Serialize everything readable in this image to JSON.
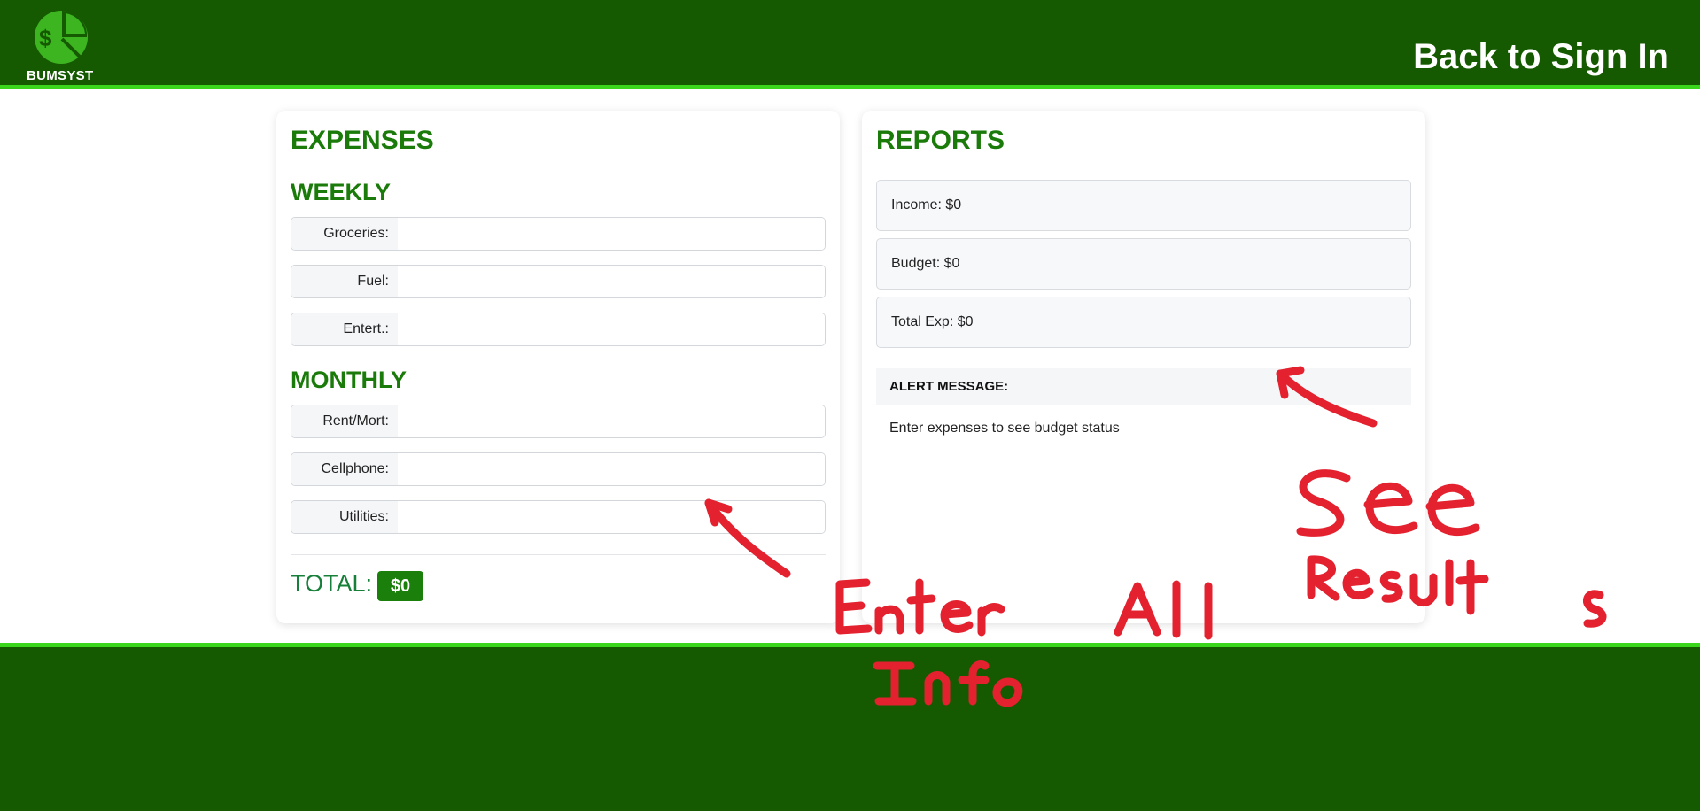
{
  "header": {
    "logo_text": "BUMSYST",
    "signin_link": "Back to Sign In"
  },
  "expenses": {
    "title": "EXPENSES",
    "weekly_title": "WEEKLY",
    "weekly": [
      {
        "label": "Groceries:",
        "value": ""
      },
      {
        "label": "Fuel:",
        "value": ""
      },
      {
        "label": "Entert.:",
        "value": ""
      }
    ],
    "monthly_title": "MONTHLY",
    "monthly": [
      {
        "label": "Rent/Mort:",
        "value": ""
      },
      {
        "label": "Cellphone:",
        "value": ""
      },
      {
        "label": "Utilities:",
        "value": ""
      }
    ],
    "total_label": "TOTAL:",
    "total_value": "$0"
  },
  "reports": {
    "title": "REPORTS",
    "items": [
      "Income: $0",
      "Budget: $0",
      "Total Exp: $0"
    ],
    "alert_title": "ALERT MESSAGE:",
    "alert_text": "Enter expenses to see budget status"
  },
  "annotations": {
    "enter_all_info": "Enter All Info",
    "see_results": "See Results"
  },
  "colors": {
    "header_bg": "#155a00",
    "accent_line": "#39d61b",
    "heading_green": "#1a7a0a",
    "total_badge": "#1b7f0b",
    "annotation_red": "#e3212f"
  }
}
